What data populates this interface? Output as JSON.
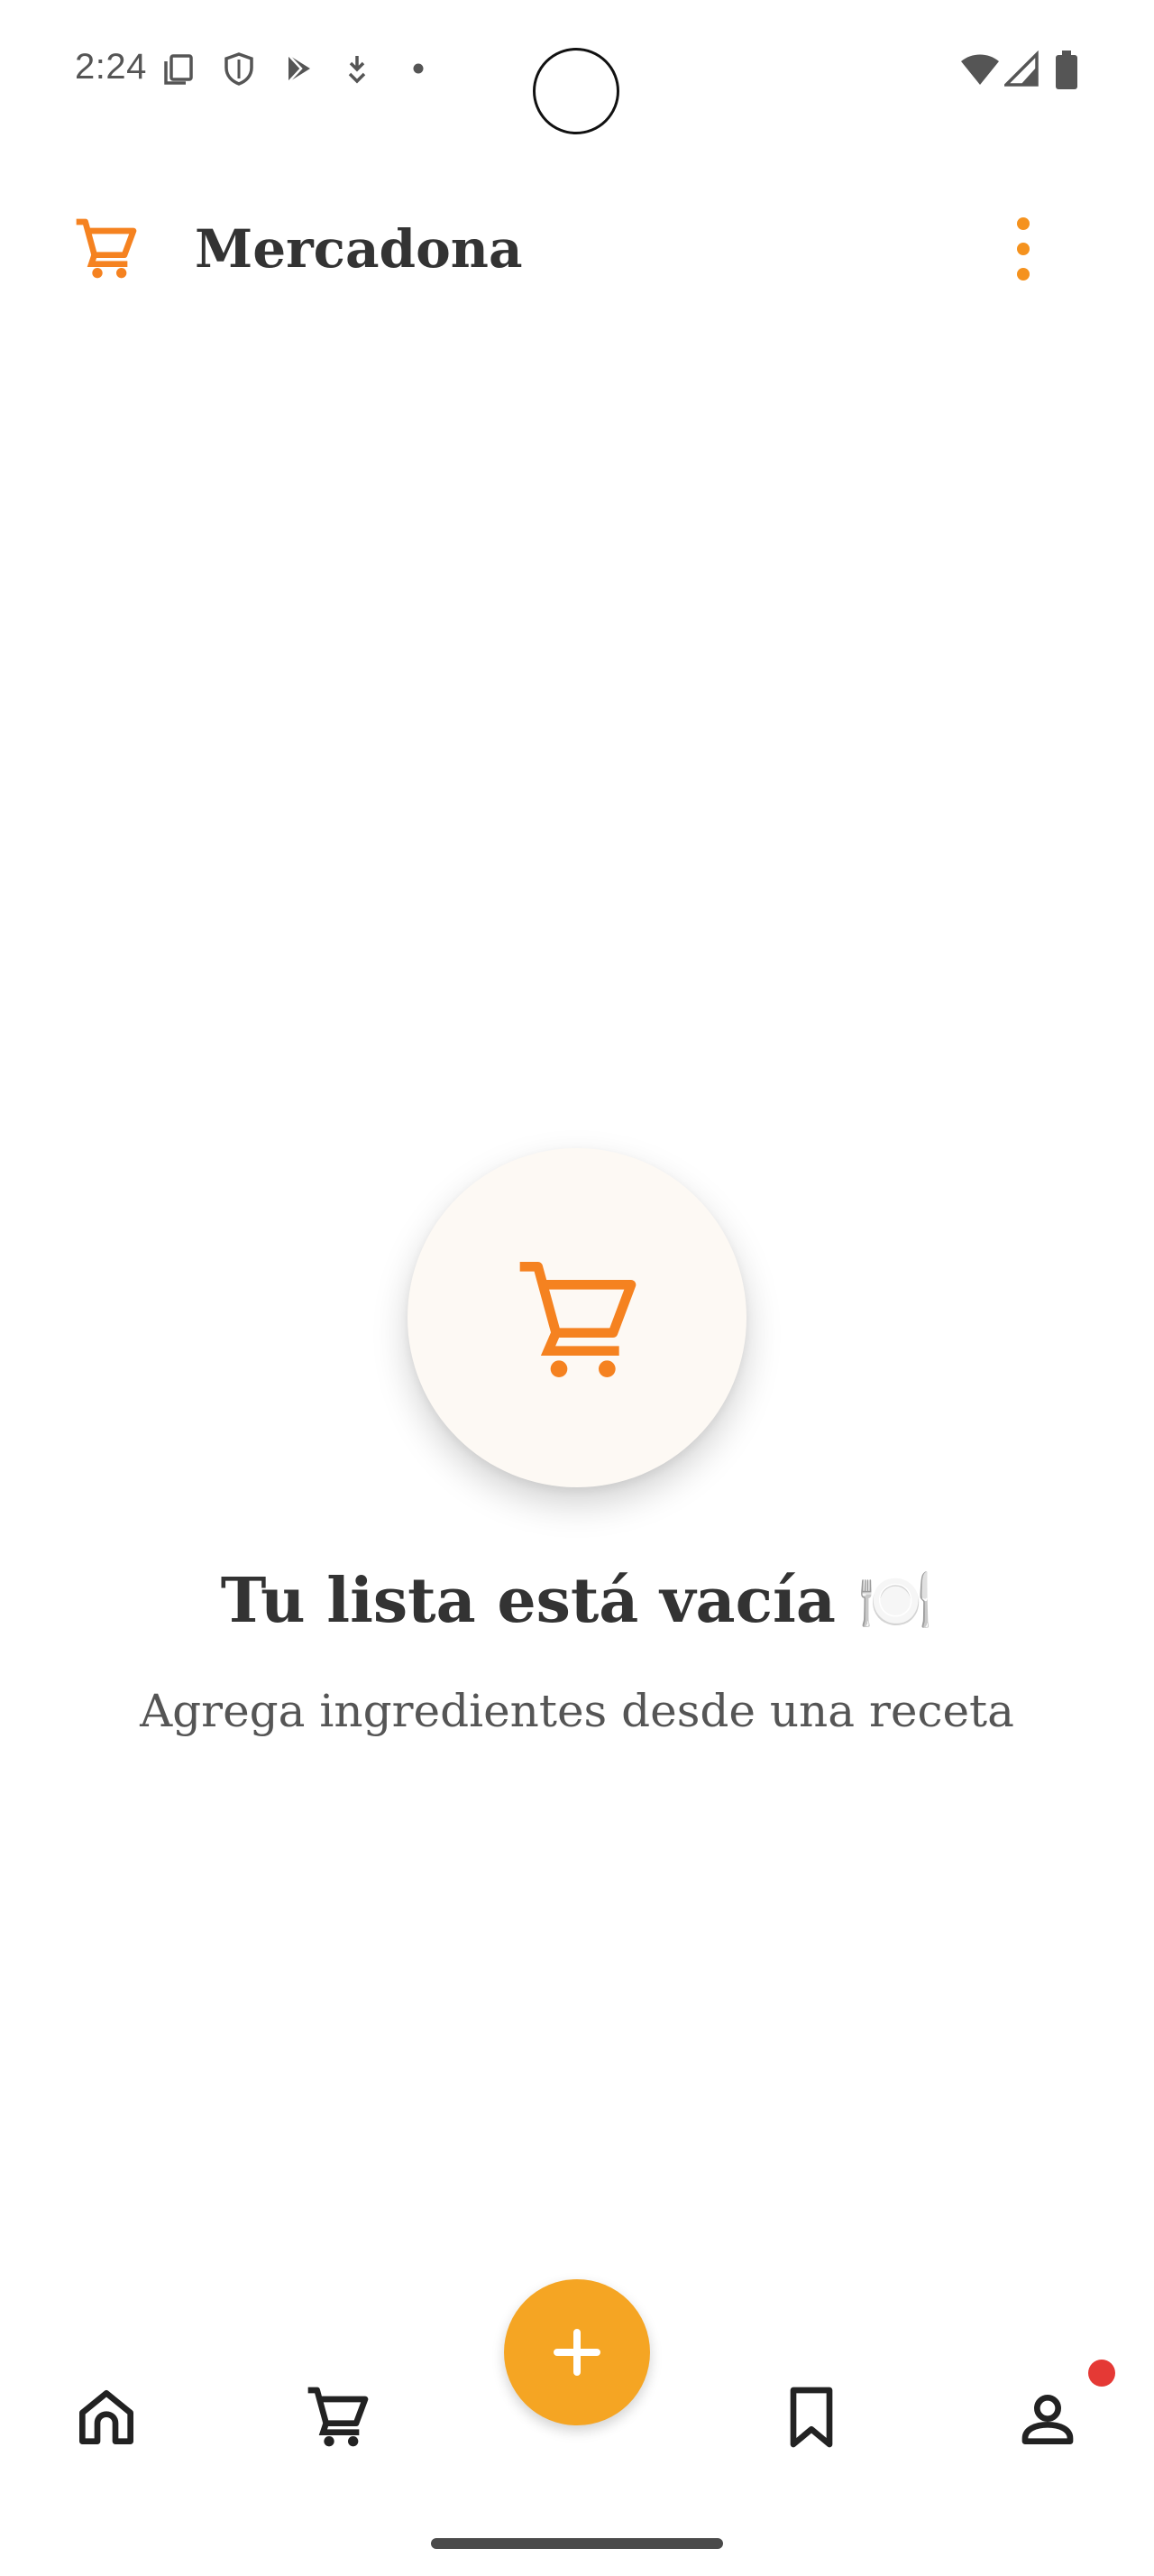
{
  "status_bar": {
    "time": "2:24",
    "icons": [
      "copy-icon",
      "shield-icon",
      "play-store-icon",
      "download-icon",
      "dot-icon",
      "wifi-icon",
      "signal-icon",
      "battery-icon"
    ]
  },
  "app_bar": {
    "title": "Mercadona",
    "logo_icon": "cart-icon",
    "menu_icon": "more-vert-icon",
    "accent_color": "#f58220"
  },
  "empty_state": {
    "icon": "cart-icon",
    "title": "Tu lista está vacía 🍽️",
    "subtitle": "Agrega ingredientes desde una receta"
  },
  "bottom_nav": {
    "items": [
      {
        "icon": "home-icon"
      },
      {
        "icon": "cart-icon"
      },
      {
        "icon": "add-icon"
      },
      {
        "icon": "bookmark-icon"
      },
      {
        "icon": "profile-icon"
      }
    ],
    "fab_color": "#f5a523",
    "badge_color": "#e53935"
  }
}
